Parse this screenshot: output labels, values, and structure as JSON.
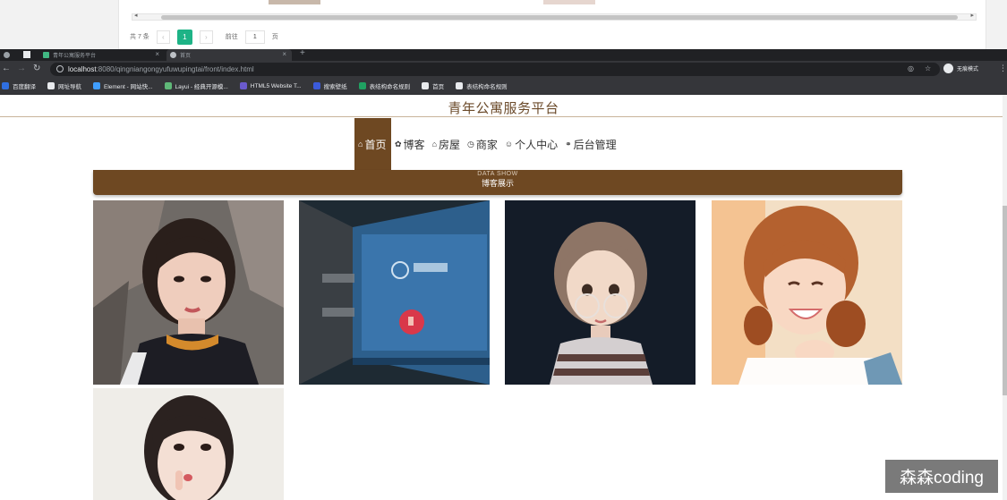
{
  "admin_panel": {
    "pager_total": "共 7 条",
    "pager_prev": "‹",
    "pager_current": "1",
    "pager_next": "›",
    "pager_goto": "前往",
    "pager_page_input": "1",
    "pager_page_suffix": "页"
  },
  "browser": {
    "tabs": [
      {
        "label": "青年公寓服务平台",
        "close": "×"
      },
      {
        "label": "首页",
        "close": "×"
      }
    ],
    "new_tab": "+",
    "url_host": "localhost",
    "url_rest": ":8080/qingniangongyufuwupingtai/front/index.html",
    "profile_label": "无痕模式",
    "bookmarks": [
      {
        "label": "百度翻译",
        "color": "#2f6fe0"
      },
      {
        "label": "网址导航",
        "color": "#e8eaed"
      },
      {
        "label": "Element - 网站快...",
        "color": "#409eff"
      },
      {
        "label": "Layui - 经典开源模...",
        "color": "#5fb878"
      },
      {
        "label": "HTML5 Website T...",
        "color": "#6a5acd"
      },
      {
        "label": "搜索壁纸",
        "color": "#3b5bdb"
      },
      {
        "label": "表结构命名规则",
        "color": "#20a162"
      },
      {
        "label": "首页",
        "color": "#e8eaed"
      },
      {
        "label": "表结构命名规则",
        "color": "#e8eaed"
      }
    ]
  },
  "site": {
    "title": "青年公寓服务平台",
    "nav": [
      {
        "icon": "⌂",
        "label": "首页",
        "active": true
      },
      {
        "icon": "✿",
        "label": "博客"
      },
      {
        "icon": "⌂",
        "label": "房屋"
      },
      {
        "icon": "◷",
        "label": "商家"
      },
      {
        "icon": "☺",
        "label": "个人中心"
      },
      {
        "icon": "⚭",
        "label": "后台管理"
      }
    ],
    "section_en": "DATA SHOW",
    "section_cn": "博客展示"
  },
  "gallery": [
    {
      "alt": "blog photo 1"
    },
    {
      "alt": "blog photo 2"
    },
    {
      "alt": "blog photo 3"
    },
    {
      "alt": "blog photo 4"
    },
    {
      "alt": "blog photo 5"
    }
  ],
  "watermark": "森森coding"
}
